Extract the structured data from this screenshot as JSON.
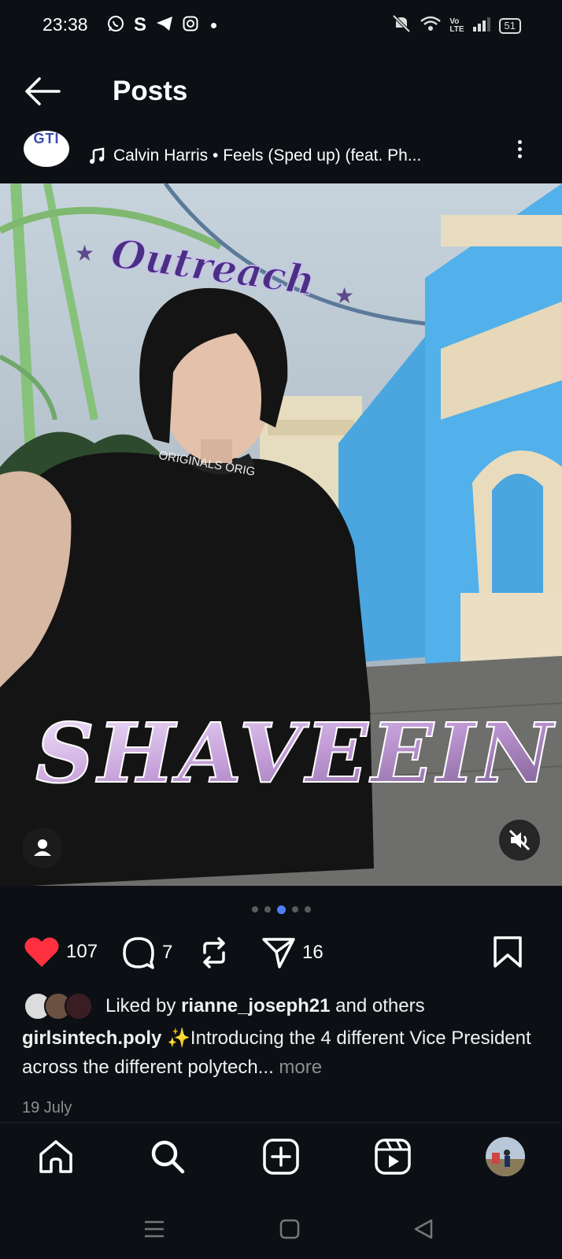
{
  "status_bar": {
    "time": "23:38",
    "battery": "51"
  },
  "header": {
    "title": "Posts"
  },
  "post": {
    "account_logo_text": "GTI",
    "music": "Calvin Harris • Feels (Sped up) (feat. Ph...",
    "overlay_top": "Outreach",
    "overlay_bottom": "SHAVEEIN",
    "collar_text": "ORIGINALS ORIG",
    "carousel": {
      "count": 5,
      "active": 2
    },
    "likes": "107",
    "comments": "7",
    "shares": "16",
    "liked_by_prefix": "Liked by",
    "liked_by_user": "rianne_joseph21",
    "liked_by_suffix": "and others",
    "author": "girlsintech.poly",
    "caption": "✨Introducing the 4 different Vice President across the different polytech...",
    "more": "more",
    "date": "19 July"
  },
  "colors": {
    "like": "#ff3040",
    "background": "#0c1014",
    "active_dot": "#4f7ef8"
  }
}
